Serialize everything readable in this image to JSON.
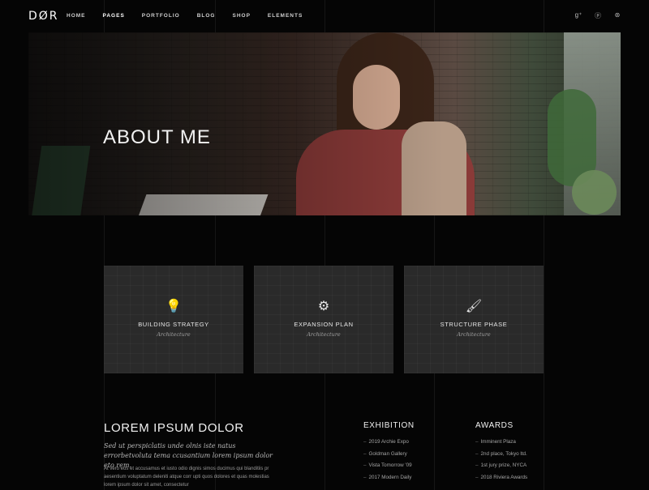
{
  "header": {
    "logo": "DØR",
    "nav": [
      {
        "label": "HOME",
        "active": false
      },
      {
        "label": "PAGES",
        "active": true
      },
      {
        "label": "PORTFOLIO",
        "active": false
      },
      {
        "label": "BLOG",
        "active": false
      },
      {
        "label": "SHOP",
        "active": false
      },
      {
        "label": "ELEMENTS",
        "active": false
      }
    ],
    "social": [
      {
        "name": "google-plus-icon",
        "glyph": "g⁺"
      },
      {
        "name": "pinterest-icon",
        "glyph": "ⓟ"
      },
      {
        "name": "dribbble-icon",
        "glyph": "⊛"
      }
    ]
  },
  "hero": {
    "title": "ABOUT ME"
  },
  "cards": [
    {
      "icon": "lightbulb-icon",
      "glyph": "💡",
      "title": "BUILDING STRATEGY",
      "subtitle": "Architecture"
    },
    {
      "icon": "gears-icon",
      "glyph": "⚙",
      "title": "EXPANSION PLAN",
      "subtitle": "Architecture"
    },
    {
      "icon": "paint-roller-icon",
      "glyph": "🖌",
      "title": "STRUCTURE PHASE",
      "subtitle": "Architecture"
    }
  ],
  "about": {
    "title": "LOREM IPSUM DOLOR",
    "subtitle": "Sed ut perspiclatis unde olnis iste natus errorbetvoluta tema ccusantium lorem ipsum dolor eto rem.",
    "body": "At vero eos et accusamus et iusto odio dignis simos ducimus qui blanditiis pr aesentium voluptatum deleniti atque corr upti quos dolores et quas molestias lorem ipsum dolor sit amet, consectetur"
  },
  "exhibition": {
    "title": "EXHIBITION",
    "items": [
      "2019 Archie Expo",
      "Goldman Gallery",
      "Vista Tomorrow '09",
      "2017 Modern Daily"
    ]
  },
  "awards": {
    "title": "AWARDS",
    "items": [
      "Imminent Plaza",
      "2nd place, Tokyo ltd.",
      "1st jury prize, NYCA",
      "2018 Riviera Awards"
    ]
  },
  "colors": {
    "background": "#050505",
    "card": "#2a2a2a",
    "text": "#f1f1f1"
  }
}
